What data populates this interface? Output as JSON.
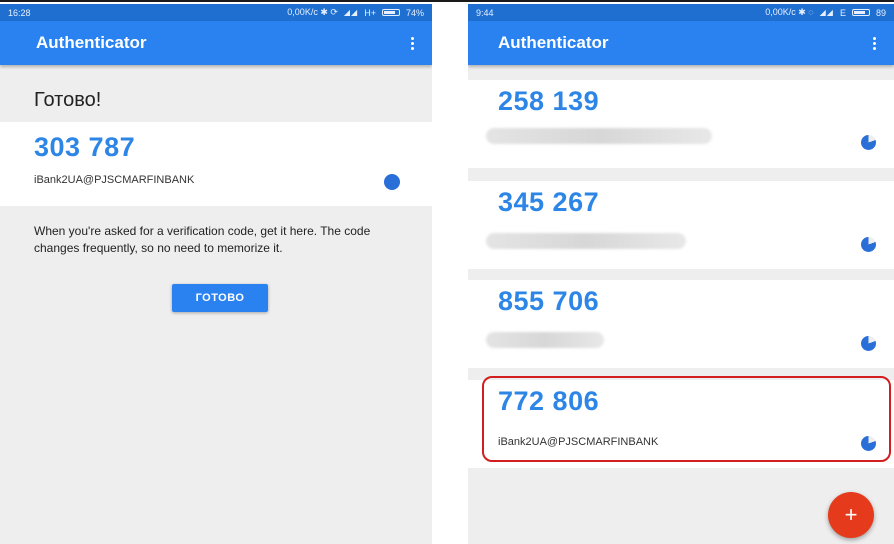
{
  "left_screen": {
    "status_bar": {
      "time": "16:28",
      "indicators": "0,00K/c ✱ ⟳",
      "network": "H+",
      "battery": "74%"
    },
    "app_bar": {
      "title": "Authenticator",
      "menu_icon": "kebab-icon"
    },
    "heading": "Готово!",
    "token": {
      "code": "303 787",
      "account": "iBank2UA@PJSCMARFINBANK"
    },
    "help_text": "When you're asked for a verification code, get it here. The code changes frequently, so no need to memorize it.",
    "done_button_label": "ГОТОВО"
  },
  "right_screen": {
    "status_bar": {
      "time": "9:44",
      "indicators": "0,00K/c ✱ ◌",
      "network": "E",
      "battery": "89"
    },
    "app_bar": {
      "title": "Authenticator",
      "menu_icon": "kebab-icon"
    },
    "tokens": [
      {
        "code": "258 139"
      },
      {
        "code": "345 267"
      },
      {
        "code": "855 706"
      },
      {
        "code": "772 806",
        "account": "iBank2UA@PJSCMARFINBANK"
      }
    ],
    "fab_label": "+"
  },
  "colors": {
    "app_bar": "#2a82f0",
    "code_text": "#2d86e6",
    "highlight": "#d21e1e",
    "fab": "#e53b1c"
  }
}
